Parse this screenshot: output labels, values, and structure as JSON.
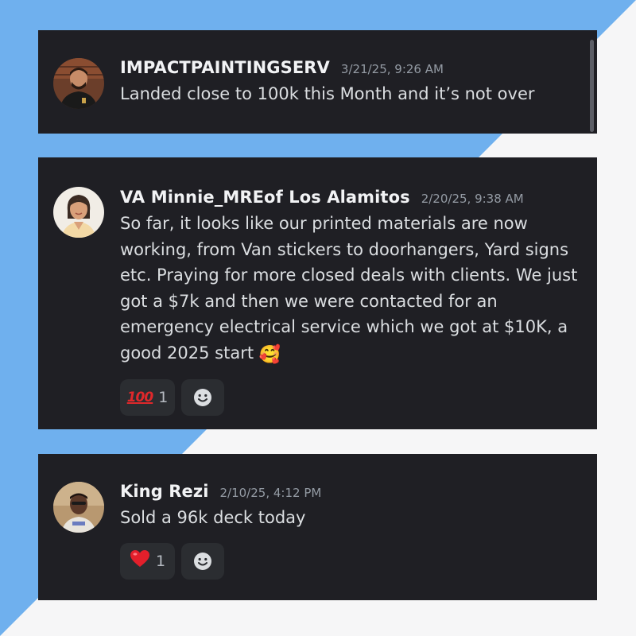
{
  "messages": [
    {
      "username": "IMPACTPAINTINGSERV",
      "timestamp": "3/21/25, 9:26 AM",
      "text": "Landed close to 100k this Month and it’s not over"
    },
    {
      "username": "VA Minnie_MREof Los Alamitos",
      "timestamp": "2/20/25, 9:38 AM",
      "text": "So far, it looks like our printed materials are now working, from Van stickers to doorhangers, Yard signs etc. Praying for more closed deals with clients. We just got a $7k and then we were contacted for an emergency electrical service which we got at $10K, a good 2025 start",
      "text_emoji": "🥰",
      "reaction": {
        "emoji": "💯",
        "label": "100",
        "count": "1"
      }
    },
    {
      "username": "King Rezi",
      "timestamp": "2/10/25, 4:12 PM",
      "text": "Sold a 96k deck today",
      "reaction": {
        "emoji": "❤️",
        "count": "1"
      }
    }
  ],
  "colors": {
    "card_bg": "#1f1f24",
    "reaction_bg": "#2b2d31",
    "bg_blue": "#6fb0ee",
    "bg_white": "#f6f6f7",
    "username": "#f2f3f5",
    "timestamp": "#949ba4",
    "text": "#dbdee1"
  },
  "icons": [
    "add-reaction-icon",
    "hundred-points-emoji",
    "red-heart-emoji",
    "smiling-face-with-hearts-emoji"
  ]
}
